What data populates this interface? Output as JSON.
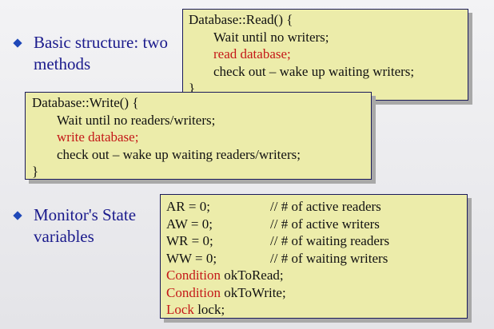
{
  "bullets": {
    "first": [
      "Basic structure: two",
      "methods"
    ],
    "second": [
      "Monitor's State",
      "variables"
    ]
  },
  "read_box": {
    "header": "Database::Read() {",
    "lines": [
      "Wait until no writers;",
      "read database;",
      "check out – wake up waiting writers;"
    ],
    "close": "}"
  },
  "write_box": {
    "header": "Database::Write() {",
    "lines": [
      "Wait until no readers/writers;",
      "write database;",
      "check out – wake up waiting readers/writers;"
    ],
    "close": "}"
  },
  "state_box": {
    "vars": [
      {
        "decl": "AR = 0;",
        "comment": "// # of active readers"
      },
      {
        "decl": "AW = 0;",
        "comment": "// # of active writers"
      },
      {
        "decl": "WR = 0;",
        "comment": "// # of waiting readers"
      },
      {
        "decl": "WW = 0;",
        "comment": "// # of waiting writers"
      }
    ],
    "typed": [
      {
        "type": "Condition",
        "rest": " okToRead;"
      },
      {
        "type": "Condition",
        "rest": " okToWrite;"
      },
      {
        "type": "Lock",
        "rest": " lock;"
      }
    ]
  },
  "colors": {
    "bullet_text": "#1a1a8c",
    "bullet_marker": "#1f48b8",
    "box_fill": "#ececaa",
    "highlight": "#c41818"
  }
}
